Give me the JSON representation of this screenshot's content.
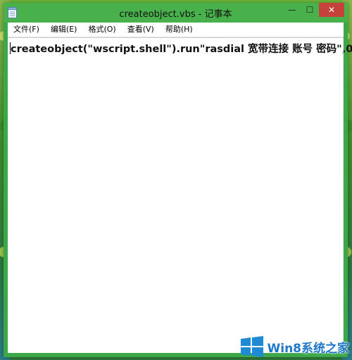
{
  "window": {
    "title": "createobject.vbs - 记事本",
    "controls": {
      "minimize": "—",
      "maximize": "☐",
      "close": "✕"
    }
  },
  "menu": {
    "items": [
      "文件(F)",
      "编辑(E)",
      "格式(O)",
      "查看(V)",
      "帮助(H)"
    ]
  },
  "editor": {
    "content": "createobject(\"wscript.shell\").run\"rasdial 宽带连接 账号 密码\",0"
  },
  "watermark": {
    "text": "Win8系统之家"
  },
  "colors": {
    "titlebar": "#49b14b",
    "close_button": "#c7423b",
    "watermark_text": "#1f77c9"
  },
  "icons": {
    "app": "notepad-icon",
    "logo": "windows-logo-icon"
  }
}
